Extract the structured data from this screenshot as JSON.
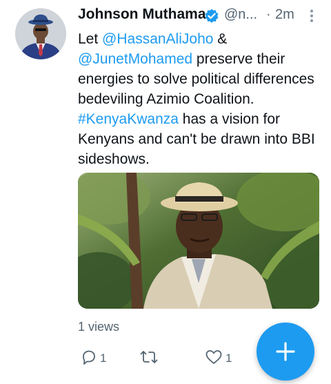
{
  "tweet": {
    "author_name": "Johnson Muthama",
    "handle": "@n...",
    "separator": "·",
    "time": "2m",
    "text_parts": [
      {
        "text": "Let ",
        "link": false
      },
      {
        "text": "@HassanAliJoho",
        "link": true
      },
      {
        "text": " & ",
        "link": false
      },
      {
        "text": "@JunetMohamed",
        "link": true
      },
      {
        "text": " preserve their energies to solve political differences bedeviling Azimio Coalition. ",
        "link": false
      },
      {
        "text": "#KenyaKwanza",
        "link": true
      },
      {
        "text": " has a vision for Kenyans and can't be drawn into BBI sideshows.",
        "link": false
      }
    ],
    "views_label": "1 views",
    "reply_count": "1",
    "retweet_count": "",
    "like_count": "1"
  },
  "colors": {
    "accent": "#1d9bf0",
    "text": "#0f1419",
    "secondary": "#536471"
  },
  "icons": {
    "verified": "verified-badge-icon",
    "more": "more-vertical-icon",
    "reply": "reply-icon",
    "retweet": "retweet-icon",
    "like": "heart-icon",
    "compose": "plus-icon"
  }
}
